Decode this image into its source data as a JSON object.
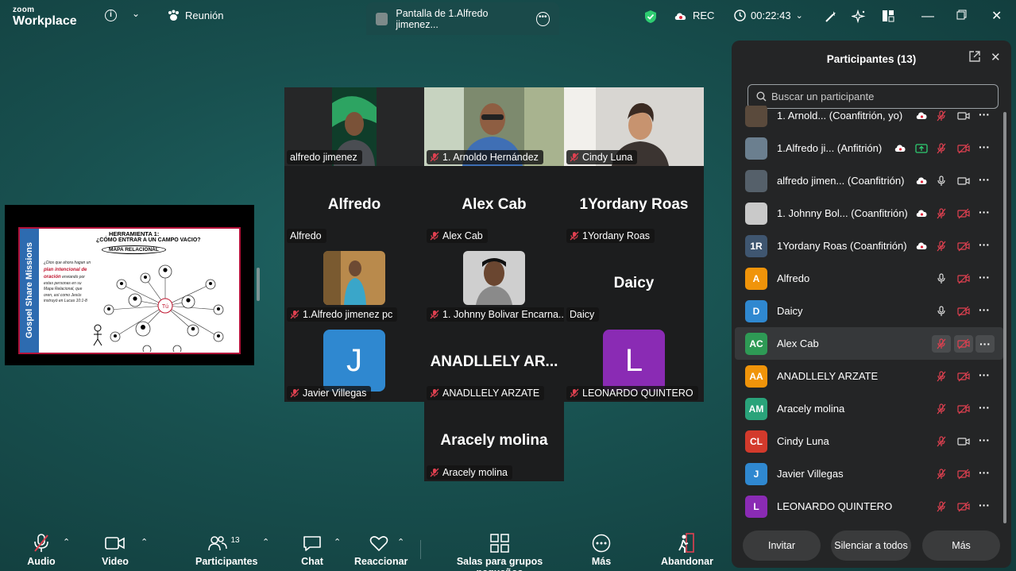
{
  "app": {
    "logo_line1": "zoom",
    "logo_line2": "Workplace"
  },
  "topbar": {
    "meeting_label": "Reunión",
    "share_tab_label": "Pantalla de 1.Alfredo jimenez...",
    "rec_label": "REC",
    "timer": "00:22:43"
  },
  "shared_slide": {
    "band_text": "Gospel Share Missions",
    "title1": "HERRAMIENTA 1:",
    "title2": "¿CÓMO ENTRAR A UN CAMPO VACIO?",
    "title3": "MAPA RELACIONAL",
    "body_prefix": "¿Dios que ahora hagan un",
    "body_highlight": "plan intencional de oración",
    "body_suffix": "enviando por estas personas en su Mapa Relacional, que oren, así como Jesús instruyó en Lucas 10:1-8",
    "center_label": "Tú"
  },
  "gallery": {
    "tiles": [
      {
        "name": "alfredo jimenez",
        "muted": false
      },
      {
        "name": "1. Arnoldo Hernández",
        "muted": true
      },
      {
        "name": "Cindy Luna",
        "muted": true
      },
      {
        "big": "Alfredo",
        "name": "Alfredo",
        "muted": false
      },
      {
        "big": "Alex Cab",
        "name": "Alex Cab",
        "muted": true
      },
      {
        "big": "1Yordany Roas",
        "name": "1Yordany Roas",
        "muted": true
      },
      {
        "name": "1.Alfredo jimenez pc",
        "muted": true
      },
      {
        "name": "1. Johnny Bolivar Encarna...",
        "muted": true
      },
      {
        "big": "Daicy",
        "name": "Daicy",
        "muted": false
      },
      {
        "avatar": "J",
        "name": "Javier Villegas",
        "muted": true
      },
      {
        "big": "ANADLLELY  AR...",
        "name": "ANADLLELY ARZATE",
        "muted": true
      },
      {
        "avatar": "L",
        "name": "LEONARDO QUINTERO",
        "muted": true
      },
      {
        "big": "Aracely molina",
        "name": "Aracely molina",
        "muted": true
      }
    ]
  },
  "toolbar": {
    "audio": "Audio",
    "video": "Video",
    "participants": "Participantes",
    "participants_count": "13",
    "chat": "Chat",
    "react": "Reaccionar",
    "rooms": "Salas para grupos pequeños",
    "more": "Más",
    "leave": "Abandonar"
  },
  "panel": {
    "title": "Participantes (13)",
    "search_placeholder": "Buscar un participante",
    "participants": [
      {
        "initials": "",
        "name": "1. Arnold...  (Coanfitrión, yo)",
        "color": "#5a4a3c"
      },
      {
        "initials": "",
        "name": "1.Alfredo ji... (Anfitrión)",
        "color": "#6b7f8f"
      },
      {
        "initials": "",
        "name": "alfredo jimen... (Coanfitrión)",
        "color": "#55606a"
      },
      {
        "initials": "",
        "name": "1. Johnny Bol... (Coanfitrión)",
        "color": "#c9c9c9"
      },
      {
        "initials": "1R",
        "name": "1Yordany Roas (Coanfitrión)",
        "color": "#3f5670"
      },
      {
        "initials": "A",
        "name": "Alfredo",
        "color": "#f0940a"
      },
      {
        "initials": "D",
        "name": "Daicy",
        "color": "#2f88d0"
      },
      {
        "initials": "AC",
        "name": "Alex Cab",
        "color": "#2e9a55"
      },
      {
        "initials": "AA",
        "name": "ANADLLELY ARZATE",
        "color": "#f0940a"
      },
      {
        "initials": "AM",
        "name": "Aracely molina",
        "color": "#2aa37a"
      },
      {
        "initials": "CL",
        "name": "Cindy Luna",
        "color": "#d33a2c"
      },
      {
        "initials": "J",
        "name": "Javier Villegas",
        "color": "#2f88d0"
      },
      {
        "initials": "L",
        "name": "LEONARDO QUINTERO",
        "color": "#8a2bb4"
      }
    ],
    "invite": "Invitar",
    "mute_all": "Silenciar a todos",
    "more": "Más"
  }
}
